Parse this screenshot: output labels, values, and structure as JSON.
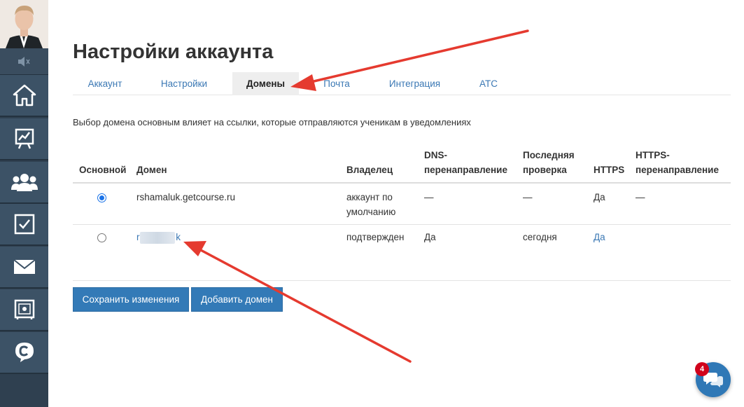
{
  "page_title": "Настройки аккаунта",
  "tabs": [
    {
      "label": "Аккаунт",
      "active": false
    },
    {
      "label": "Настройки",
      "active": false
    },
    {
      "label": "Домены",
      "active": true
    },
    {
      "label": "Почта",
      "active": false
    },
    {
      "label": "Интеграция",
      "active": false
    },
    {
      "label": "АТС",
      "active": false
    }
  ],
  "info_text": "Выбор домена основным влияет на ссылки, которые отправляются ученикам в уведомлениях",
  "table": {
    "headers": {
      "main": "Основной",
      "domain": "Домен",
      "owner": "Владелец",
      "dns_line1": "DNS-",
      "dns_line2": "перенаправление",
      "check_line1": "Последняя",
      "check_line2": "проверка",
      "https": "HTTPS",
      "https_redirect_line1": "HTTPS-",
      "https_redirect_line2": "перенаправление"
    },
    "rows": [
      {
        "selected": true,
        "domain": "rshamaluk.getcourse.ru",
        "owner_line1": "аккаунт по",
        "owner_line2": "умолчанию",
        "dns": "—",
        "last_check": "—",
        "https": "Да",
        "https_redirect": "—"
      },
      {
        "selected": false,
        "domain_prefix": "rs",
        "domain_suffix": "k",
        "owner_line1": "подтвержден",
        "dns": "Да",
        "last_check": "сегодня",
        "https": "Да"
      }
    ]
  },
  "buttons": {
    "save": "Сохранить изменения",
    "add_domain": "Добавить домен"
  },
  "chat": {
    "badge_count": "4"
  },
  "sidebar": {
    "items": [
      "home-icon",
      "chart-icon",
      "users-icon",
      "tasks-icon",
      "mail-icon",
      "safe-icon",
      "getcourse-logo-icon"
    ]
  },
  "colors": {
    "sidebar_bg": "#2f4050",
    "sidebar_item": "#3c5266",
    "link": "#3b78b4",
    "button": "#337ab7",
    "annotation_arrow": "#e53a2f",
    "badge": "#d0021b"
  }
}
